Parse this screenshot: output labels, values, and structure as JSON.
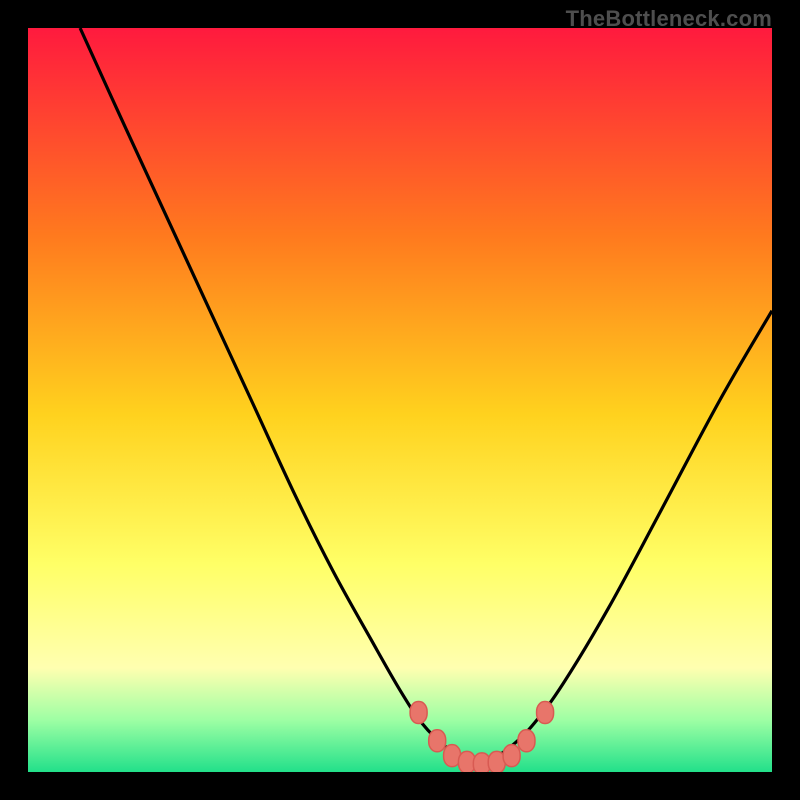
{
  "watermark": "TheBottleneck.com",
  "colors": {
    "bg": "#000000",
    "grad_top": "#ff1a3e",
    "grad_mid1": "#ff7a1e",
    "grad_mid2": "#ffd21e",
    "grad_mid3": "#ffff66",
    "grad_mid4": "#ffffb0",
    "grad_bottom1": "#9effa4",
    "grad_bottom2": "#22e08a",
    "curve": "#000000",
    "marker_fill": "#e8756a",
    "marker_stroke": "#d85a52"
  },
  "chart_data": {
    "type": "line",
    "title": "",
    "xlabel": "",
    "ylabel": "",
    "xlim": [
      0,
      100
    ],
    "ylim": [
      0,
      100
    ],
    "axes_visible": false,
    "background": "vertical-gradient red→yellow→green",
    "series": [
      {
        "name": "bottleneck-curve",
        "x": [
          7,
          12,
          18,
          24,
          30,
          36,
          41,
          46,
          50,
          53,
          56,
          58.5,
          60.5,
          62.5,
          65,
          68,
          72,
          78,
          85,
          93,
          100
        ],
        "values": [
          100,
          89,
          76,
          63,
          50,
          37,
          27,
          18,
          11,
          6.5,
          3.5,
          1.8,
          1.2,
          1.8,
          3.5,
          6.5,
          12,
          22,
          35,
          50,
          62
        ]
      }
    ],
    "markers": {
      "name": "highlight-points",
      "shape": "rounded-rect",
      "x": [
        52.5,
        55,
        57,
        59,
        61,
        63,
        65,
        67,
        69.5
      ],
      "values": [
        8,
        4.2,
        2.2,
        1.3,
        1.1,
        1.3,
        2.2,
        4.2,
        8
      ]
    }
  }
}
